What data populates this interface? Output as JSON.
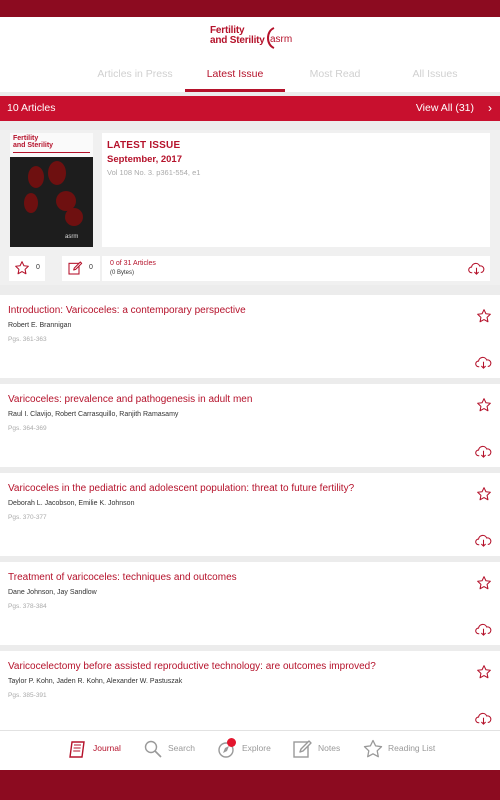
{
  "brand": {
    "title_line1": "Fertility",
    "title_line2": "and Sterility",
    "org": "asrm"
  },
  "tabs": [
    {
      "label": "Articles in Press",
      "active": false
    },
    {
      "label": "Latest Issue",
      "active": true
    },
    {
      "label": "Most Read",
      "active": false
    },
    {
      "label": "All Issues",
      "active": false
    }
  ],
  "section": {
    "title": "10 Articles",
    "view_all": "View All (31)"
  },
  "issue": {
    "cover_title_line1": "Fertility",
    "cover_title_line2": "and Sterility",
    "cover_logo": "asrm",
    "label": "LATEST ISSUE",
    "date": "September, 2017",
    "volume": "Vol 108 No. 3. p361-554, e1",
    "favorites_count": "0",
    "notes_count": "0",
    "downloaded": "0 of 31 Articles",
    "downloaded_size": "(0 Bytes)"
  },
  "articles": [
    {
      "title": "Introduction: Varicoceles: a contemporary perspective",
      "authors": "Robert E. Brannigan",
      "pages": "Pgs. 361-363"
    },
    {
      "title": "Varicoceles: prevalence and pathogenesis in adult men",
      "authors": "Raul I. Clavijo, Robert Carrasquillo, Ranjith Ramasamy",
      "pages": "Pgs. 364-369"
    },
    {
      "title": "Varicoceles in the pediatric and adolescent population: threat to future fertility?",
      "authors": "Deborah L. Jacobson, Emilie K. Johnson",
      "pages": "Pgs. 370-377"
    },
    {
      "title": "Treatment of varicoceles: techniques and outcomes",
      "authors": "Dane Johnson, Jay Sandlow",
      "pages": "Pgs. 378-384"
    },
    {
      "title": "Varicocelectomy before assisted reproductive technology: are outcomes improved?",
      "authors": "Taylor P. Kohn, Jaden R. Kohn, Alexander W. Pastuszak",
      "pages": "Pgs. 385-391"
    }
  ],
  "bottom_nav": [
    {
      "label": "Journal",
      "icon": "journal-icon",
      "active": true
    },
    {
      "label": "Search",
      "icon": "search-icon",
      "active": false
    },
    {
      "label": "Explore",
      "icon": "explore-icon",
      "active": false
    },
    {
      "label": "Notes",
      "icon": "notes-icon",
      "active": false
    },
    {
      "label": "Reading List",
      "icon": "star-icon",
      "active": false
    }
  ],
  "colors": {
    "brand": "#c8102e",
    "brand_dark": "#8c0b20",
    "muted": "#aaaaaa"
  }
}
